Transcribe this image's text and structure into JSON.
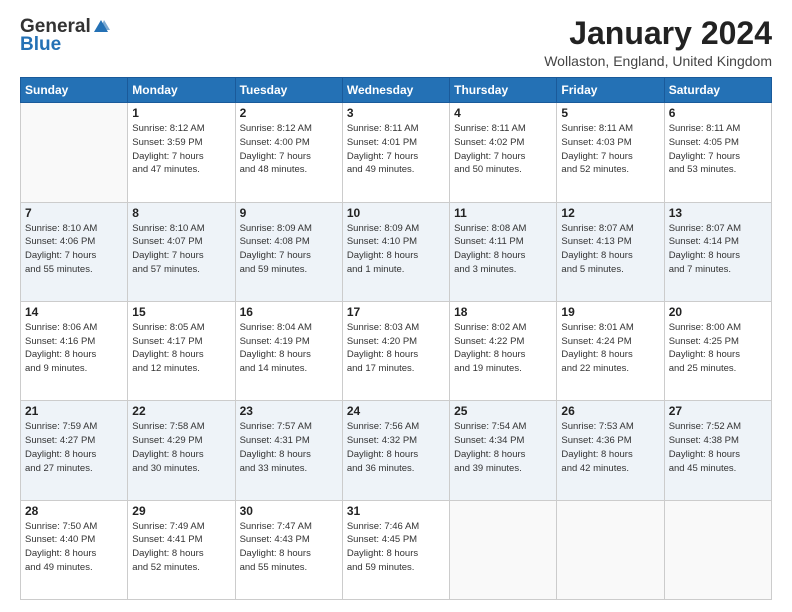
{
  "logo": {
    "general": "General",
    "blue": "Blue"
  },
  "title": "January 2024",
  "location": "Wollaston, England, United Kingdom",
  "days_of_week": [
    "Sunday",
    "Monday",
    "Tuesday",
    "Wednesday",
    "Thursday",
    "Friday",
    "Saturday"
  ],
  "weeks": [
    [
      {
        "day": "",
        "info": ""
      },
      {
        "day": "1",
        "info": "Sunrise: 8:12 AM\nSunset: 3:59 PM\nDaylight: 7 hours\nand 47 minutes."
      },
      {
        "day": "2",
        "info": "Sunrise: 8:12 AM\nSunset: 4:00 PM\nDaylight: 7 hours\nand 48 minutes."
      },
      {
        "day": "3",
        "info": "Sunrise: 8:11 AM\nSunset: 4:01 PM\nDaylight: 7 hours\nand 49 minutes."
      },
      {
        "day": "4",
        "info": "Sunrise: 8:11 AM\nSunset: 4:02 PM\nDaylight: 7 hours\nand 50 minutes."
      },
      {
        "day": "5",
        "info": "Sunrise: 8:11 AM\nSunset: 4:03 PM\nDaylight: 7 hours\nand 52 minutes."
      },
      {
        "day": "6",
        "info": "Sunrise: 8:11 AM\nSunset: 4:05 PM\nDaylight: 7 hours\nand 53 minutes."
      }
    ],
    [
      {
        "day": "7",
        "info": ""
      },
      {
        "day": "8",
        "info": "Sunrise: 8:10 AM\nSunset: 4:07 PM\nDaylight: 7 hours\nand 57 minutes."
      },
      {
        "day": "9",
        "info": "Sunrise: 8:09 AM\nSunset: 4:08 PM\nDaylight: 7 hours\nand 59 minutes."
      },
      {
        "day": "10",
        "info": "Sunrise: 8:09 AM\nSunset: 4:10 PM\nDaylight: 8 hours\nand 1 minute."
      },
      {
        "day": "11",
        "info": "Sunrise: 8:08 AM\nSunset: 4:11 PM\nDaylight: 8 hours\nand 3 minutes."
      },
      {
        "day": "12",
        "info": "Sunrise: 8:07 AM\nSunset: 4:13 PM\nDaylight: 8 hours\nand 5 minutes."
      },
      {
        "day": "13",
        "info": "Sunrise: 8:07 AM\nSunset: 4:14 PM\nDaylight: 8 hours\nand 7 minutes."
      }
    ],
    [
      {
        "day": "14",
        "info": ""
      },
      {
        "day": "15",
        "info": "Sunrise: 8:05 AM\nSunset: 4:17 PM\nDaylight: 8 hours\nand 12 minutes."
      },
      {
        "day": "16",
        "info": "Sunrise: 8:04 AM\nSunset: 4:19 PM\nDaylight: 8 hours\nand 14 minutes."
      },
      {
        "day": "17",
        "info": "Sunrise: 8:03 AM\nSunset: 4:20 PM\nDaylight: 8 hours\nand 17 minutes."
      },
      {
        "day": "18",
        "info": "Sunrise: 8:02 AM\nSunset: 4:22 PM\nDaylight: 8 hours\nand 19 minutes."
      },
      {
        "day": "19",
        "info": "Sunrise: 8:01 AM\nSunset: 4:24 PM\nDaylight: 8 hours\nand 22 minutes."
      },
      {
        "day": "20",
        "info": "Sunrise: 8:00 AM\nSunset: 4:25 PM\nDaylight: 8 hours\nand 25 minutes."
      }
    ],
    [
      {
        "day": "21",
        "info": ""
      },
      {
        "day": "22",
        "info": "Sunrise: 7:58 AM\nSunset: 4:29 PM\nDaylight: 8 hours\nand 30 minutes."
      },
      {
        "day": "23",
        "info": "Sunrise: 7:57 AM\nSunset: 4:31 PM\nDaylight: 8 hours\nand 33 minutes."
      },
      {
        "day": "24",
        "info": "Sunrise: 7:56 AM\nSunset: 4:32 PM\nDaylight: 8 hours\nand 36 minutes."
      },
      {
        "day": "25",
        "info": "Sunrise: 7:54 AM\nSunset: 4:34 PM\nDaylight: 8 hours\nand 39 minutes."
      },
      {
        "day": "26",
        "info": "Sunrise: 7:53 AM\nSunset: 4:36 PM\nDaylight: 8 hours\nand 42 minutes."
      },
      {
        "day": "27",
        "info": "Sunrise: 7:52 AM\nSunset: 4:38 PM\nDaylight: 8 hours\nand 45 minutes."
      }
    ],
    [
      {
        "day": "28",
        "info": "Sunrise: 7:50 AM\nSunset: 4:40 PM\nDaylight: 8 hours\nand 49 minutes."
      },
      {
        "day": "29",
        "info": "Sunrise: 7:49 AM\nSunset: 4:41 PM\nDaylight: 8 hours\nand 52 minutes."
      },
      {
        "day": "30",
        "info": "Sunrise: 7:47 AM\nSunset: 4:43 PM\nDaylight: 8 hours\nand 55 minutes."
      },
      {
        "day": "31",
        "info": "Sunrise: 7:46 AM\nSunset: 4:45 PM\nDaylight: 8 hours\nand 59 minutes."
      },
      {
        "day": "",
        "info": ""
      },
      {
        "day": "",
        "info": ""
      },
      {
        "day": "",
        "info": ""
      }
    ]
  ],
  "week1_sunday_info": "Sunrise: 8:10 AM\nSunset: 4:06 PM\nDaylight: 7 hours\nand 55 minutes.",
  "week3_sunday_info": "Sunrise: 8:06 AM\nSunset: 4:16 PM\nDaylight: 8 hours\nand 9 minutes.",
  "week4_sunday_info": "Sunrise: 7:59 AM\nSunset: 4:27 PM\nDaylight: 8 hours\nand 27 minutes."
}
